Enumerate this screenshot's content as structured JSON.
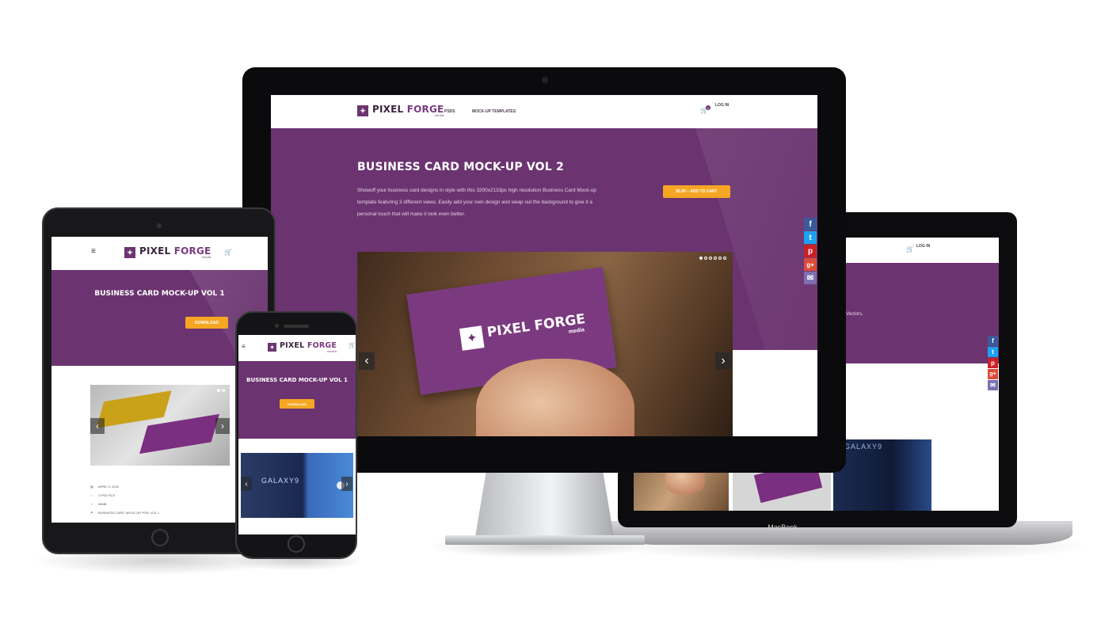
{
  "site": {
    "logo_main": "PIXEL ",
    "logo_accent": "FORGE",
    "logo_sub": "media",
    "logo_mark": "✦"
  },
  "desktop": {
    "nav": [
      "PSDS",
      "MOCK-UP TEMPLATES"
    ],
    "login": "LOG IN",
    "cart_count": "0",
    "title": "BUSINESS CARD MOCK-UP VOL 2",
    "description": "Showoff your business card designs in style with this 3200x2133px high resolution Business Card Mock-up template featuring 3 different views. Easily add your own design and swap out the background to give it a personal touch that will make it look even better.",
    "cta": "$5.00 – ADD TO CART",
    "slider_prev": "‹",
    "slider_next": "›"
  },
  "tablet": {
    "menu_icon": "≡",
    "title": "BUSINESS CARD MOCK-UP VOL 1",
    "button": "DOWNLOAD",
    "meta": [
      "APRIL 3, 2015",
      "1 PSD FILE",
      "38MB",
      "BUSINESS CARD, MOCK-UP, PSD, VOL 1"
    ]
  },
  "phone": {
    "menu_icon": "≡",
    "title": "BUSINESS CARD MOCK-UP VOL 1",
    "button": "DOWNLOAD",
    "galaxy": "GALAXY9"
  },
  "laptop": {
    "login": "LOG IN",
    "partial_text": "Vectors,",
    "brand": "MacBook",
    "galaxy": "GALAXY9"
  },
  "social": {
    "fb": "f",
    "tw": "t",
    "pi": "p",
    "gp": "g+",
    "em": "✉"
  },
  "colors": {
    "purple": "#6b3470",
    "orange": "#f5a623"
  }
}
